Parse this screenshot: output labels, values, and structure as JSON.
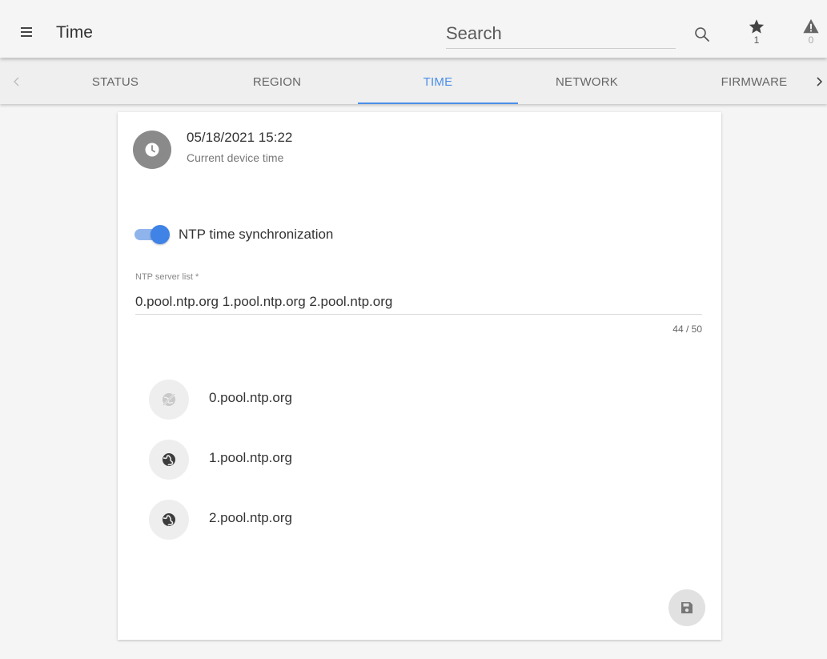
{
  "appbar": {
    "title": "Time",
    "search_placeholder": "Search",
    "favorites_count": "1",
    "alerts_count": "0"
  },
  "tabs": {
    "items": [
      {
        "label": "STATUS",
        "active": false
      },
      {
        "label": "REGION",
        "active": false
      },
      {
        "label": "TIME",
        "active": true
      },
      {
        "label": "NETWORK",
        "active": false
      },
      {
        "label": "FIRMWARE",
        "active": false
      }
    ],
    "accent": "#4a8fe8"
  },
  "device_time": {
    "value": "05/18/2021 15:22",
    "caption": "Current device time"
  },
  "ntp": {
    "sync_label": "NTP time synchronization",
    "sync_enabled": true,
    "field_label": "NTP server list *",
    "field_value": "0.pool.ntp.org 1.pool.ntp.org 2.pool.ntp.org",
    "counter": "44 / 50",
    "servers": [
      {
        "name": "0.pool.ntp.org",
        "icon": "globe-off-icon"
      },
      {
        "name": "1.pool.ntp.org",
        "icon": "globe-icon"
      },
      {
        "name": "2.pool.ntp.org",
        "icon": "globe-icon"
      }
    ]
  },
  "actions": {
    "save_icon": "save-icon"
  },
  "colors": {
    "accent": "#4a8fe8",
    "toggle_track": "#8fb4ec",
    "toggle_thumb": "#3f83e6",
    "background": "#f5f5f5"
  }
}
